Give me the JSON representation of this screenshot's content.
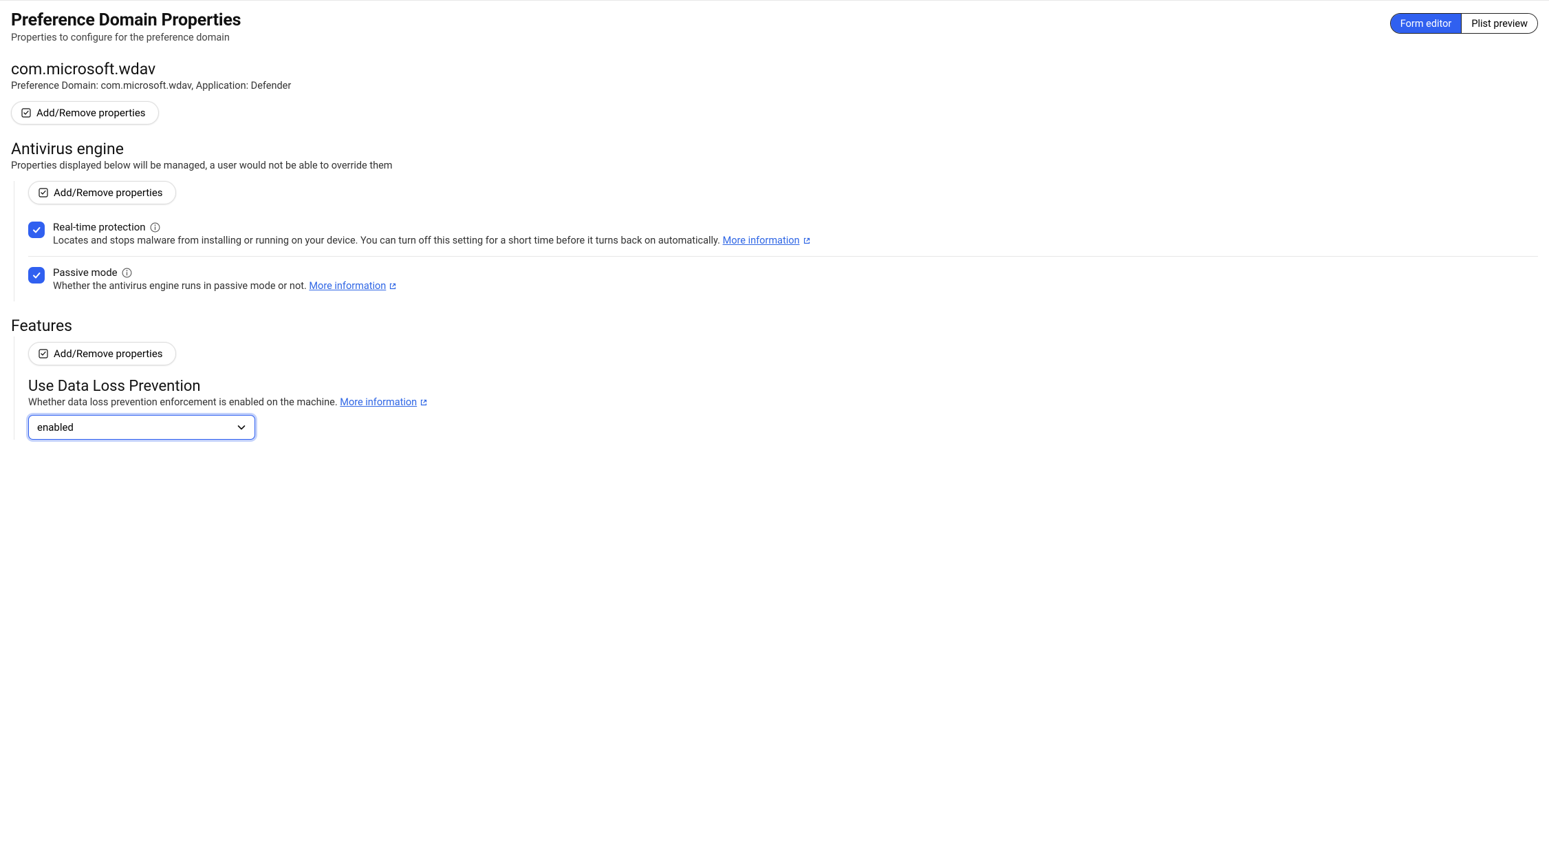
{
  "header": {
    "title": "Preference Domain Properties",
    "subtitle": "Properties to configure for the preference domain",
    "form_editor_label": "Form editor",
    "plist_preview_label": "Plist preview"
  },
  "domain": {
    "title": "com.microsoft.wdav",
    "subtitle": "Preference Domain: com.microsoft.wdav, Application: Defender",
    "add_remove_label": "Add/Remove properties"
  },
  "antivirus": {
    "title": "Antivirus engine",
    "subtitle": "Properties displayed below will be managed, a user would not be able to override them",
    "add_remove_label": "Add/Remove properties",
    "realtime": {
      "label": "Real-time protection",
      "desc": "Locates and stops malware from installing or running on your device. You can turn off this setting for a short time before it turns back on automatically.",
      "link": "More information"
    },
    "passive": {
      "label": "Passive mode",
      "desc": "Whether the antivirus engine runs in passive mode or not.",
      "link": "More information"
    }
  },
  "features": {
    "title": "Features",
    "add_remove_label": "Add/Remove properties",
    "dlp": {
      "title": "Use Data Loss Prevention",
      "desc": "Whether data loss prevention enforcement is enabled on the machine.",
      "link": "More information",
      "selected": "enabled"
    }
  }
}
